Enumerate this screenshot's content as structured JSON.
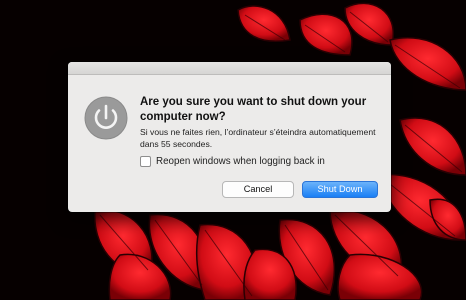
{
  "dialog": {
    "title": "Are you sure you want to shut down your computer now?",
    "message": "Si vous ne faites rien, l’ordinateur s’éteindra automatiquement dans 55 secondes.",
    "checkbox": {
      "label": "Reopen windows when logging back in",
      "checked": false
    },
    "buttons": {
      "cancel": "Cancel",
      "shutdown": "Shut Down"
    },
    "icon": "power-icon"
  },
  "colors": {
    "wallpaper_red": "#e3111b",
    "default_button": "#1a7ff5",
    "dialog_background": "#ecebea"
  }
}
